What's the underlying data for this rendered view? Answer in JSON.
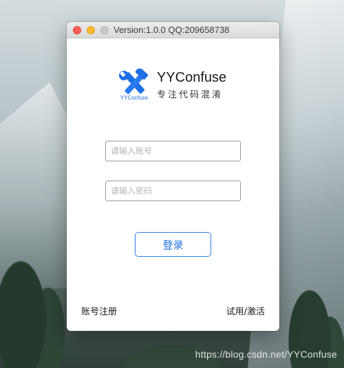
{
  "window": {
    "title": "Version:1.0.0 QQ:209658738"
  },
  "logo": {
    "icon": "hammer-wrench-icon",
    "caption": "YYConfuse",
    "name": "YYConfuse",
    "slogan": "专注代码混淆",
    "color": "#1e6fe6"
  },
  "form": {
    "username_placeholder": "请输入账号",
    "username_value": "",
    "password_placeholder": "请输入密码",
    "password_value": "",
    "login_label": "登录"
  },
  "footer": {
    "register_label": "账号注册",
    "trial_label": "试用/激活"
  },
  "watermark": "https://blog.csdn.net/YYConfuse"
}
